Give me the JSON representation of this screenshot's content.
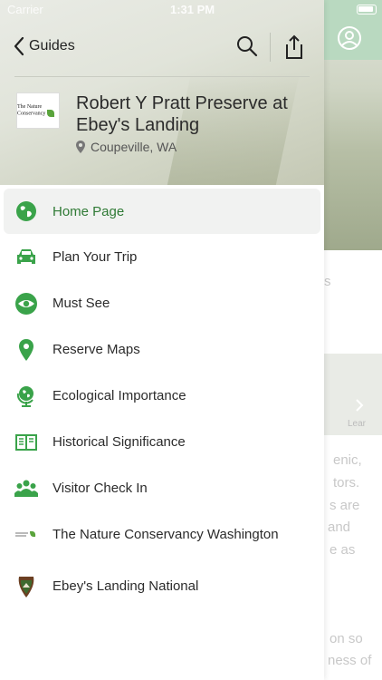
{
  "status_bar": {
    "carrier": "Carrier",
    "time": "1:31 PM"
  },
  "header": {
    "back_label": "Guides",
    "title": "Robert Y Pratt Preserve at Ebey's Landing",
    "location": "Coupeville, WA",
    "logo_text": "The Nature Conservancy"
  },
  "menu": {
    "items": [
      {
        "label": "Home Page",
        "icon": "globe-icon",
        "active": true
      },
      {
        "label": "Plan Your Trip",
        "icon": "car-icon"
      },
      {
        "label": "Must See",
        "icon": "eye-icon"
      },
      {
        "label": "Reserve Maps",
        "icon": "map-pin-icon"
      },
      {
        "label": "Ecological Importance",
        "icon": "globe-stand-icon"
      },
      {
        "label": "Historical Significance",
        "icon": "book-icon"
      },
      {
        "label": "Visitor Check In",
        "icon": "people-icon"
      },
      {
        "label": "The Nature Conservancy Washington",
        "icon": "tnc-logo-icon"
      },
      {
        "label": "Ebey's Landing National",
        "icon": "nps-arrowhead-icon"
      }
    ]
  },
  "background": {
    "fragments": [
      "s",
      "enic,",
      "tors.",
      "s are",
      "and",
      "e as",
      "on so",
      "ness of"
    ],
    "card_label": "Lear"
  },
  "colors": {
    "accent_green": "#2f7a35",
    "icon_green": "#3aa34a",
    "drawer_bg": "#ffffff"
  }
}
